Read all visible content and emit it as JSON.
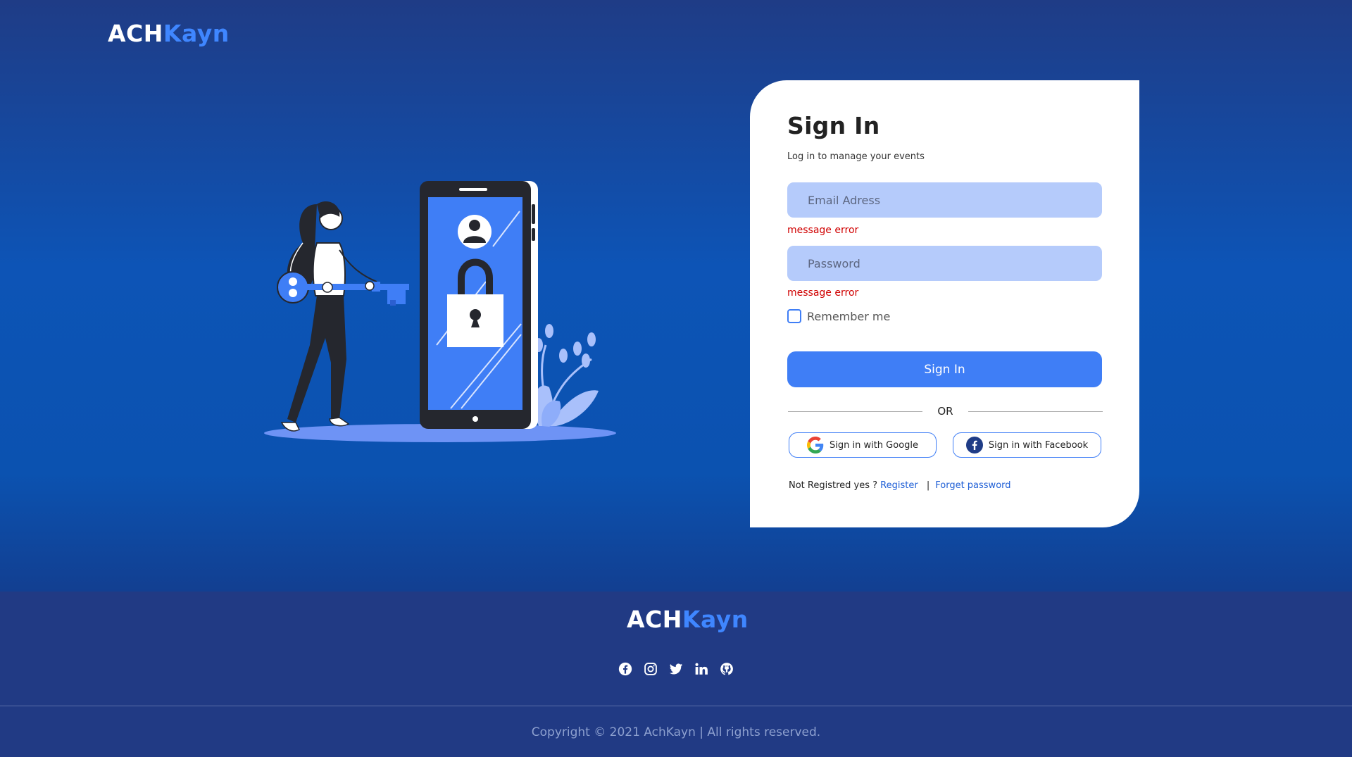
{
  "brand": {
    "part1": "ACH",
    "part2": "Kayn"
  },
  "signin": {
    "title": "Sign In",
    "subtitle": "Log in to manage your events",
    "email_placeholder": "Email Adress",
    "email_error": "message error",
    "password_placeholder": "Password",
    "password_error": "message error",
    "remember_label": "Remember me",
    "button_label": "Sign In",
    "or_label": "OR",
    "google_label": "Sign in with Google",
    "facebook_label": "Sign in with Facebook",
    "not_registered": "Not Registred yes ?",
    "register_link": "Register",
    "separator": "|",
    "forget_link": "Forget password"
  },
  "footer": {
    "brand_part1": "ACH",
    "brand_part2": "Kayn",
    "social_icons": [
      "facebook-icon",
      "instagram-icon",
      "twitter-icon",
      "linkedin-icon",
      "github-icon"
    ],
    "copyright": "Copyright © 2021 AchKayn | All rights reserved."
  },
  "colors": {
    "accent": "#3f7ef6",
    "input_bg": "#b5cbfb",
    "error": "#d00000",
    "footer_bg": "#213a84"
  }
}
